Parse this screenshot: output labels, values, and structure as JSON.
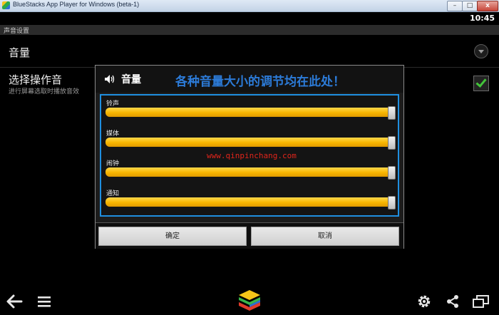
{
  "window": {
    "title": "BlueStacks App Player for Windows (beta-1)"
  },
  "status_bar": {
    "time": "10:45"
  },
  "settings": {
    "header": "声音设置",
    "volume_row": {
      "label": "音量"
    },
    "sound_row": {
      "label": "选择操作音",
      "sub": "进行屏幕选取时播放音效",
      "checked": true
    }
  },
  "dialog": {
    "title": "音量",
    "annotation": "各种音量大小的调节均在此处！",
    "watermark": "www.qinpinchang.com",
    "sliders": [
      {
        "label": "铃声",
        "value": 100
      },
      {
        "label": "媒体",
        "value": 100
      },
      {
        "label": "闹钟",
        "value": 100
      },
      {
        "label": "通知",
        "value": 100
      }
    ],
    "ok_label": "确定",
    "cancel_label": "取消"
  },
  "nav": {
    "icons": [
      "back-icon",
      "menu-icon",
      "bluestacks-logo",
      "gear-icon",
      "share-icon",
      "window-icon"
    ]
  },
  "colors": {
    "accent_blue": "#1f8fe0",
    "slider_yellow": "#f7b500",
    "check_green": "#43c43a"
  }
}
